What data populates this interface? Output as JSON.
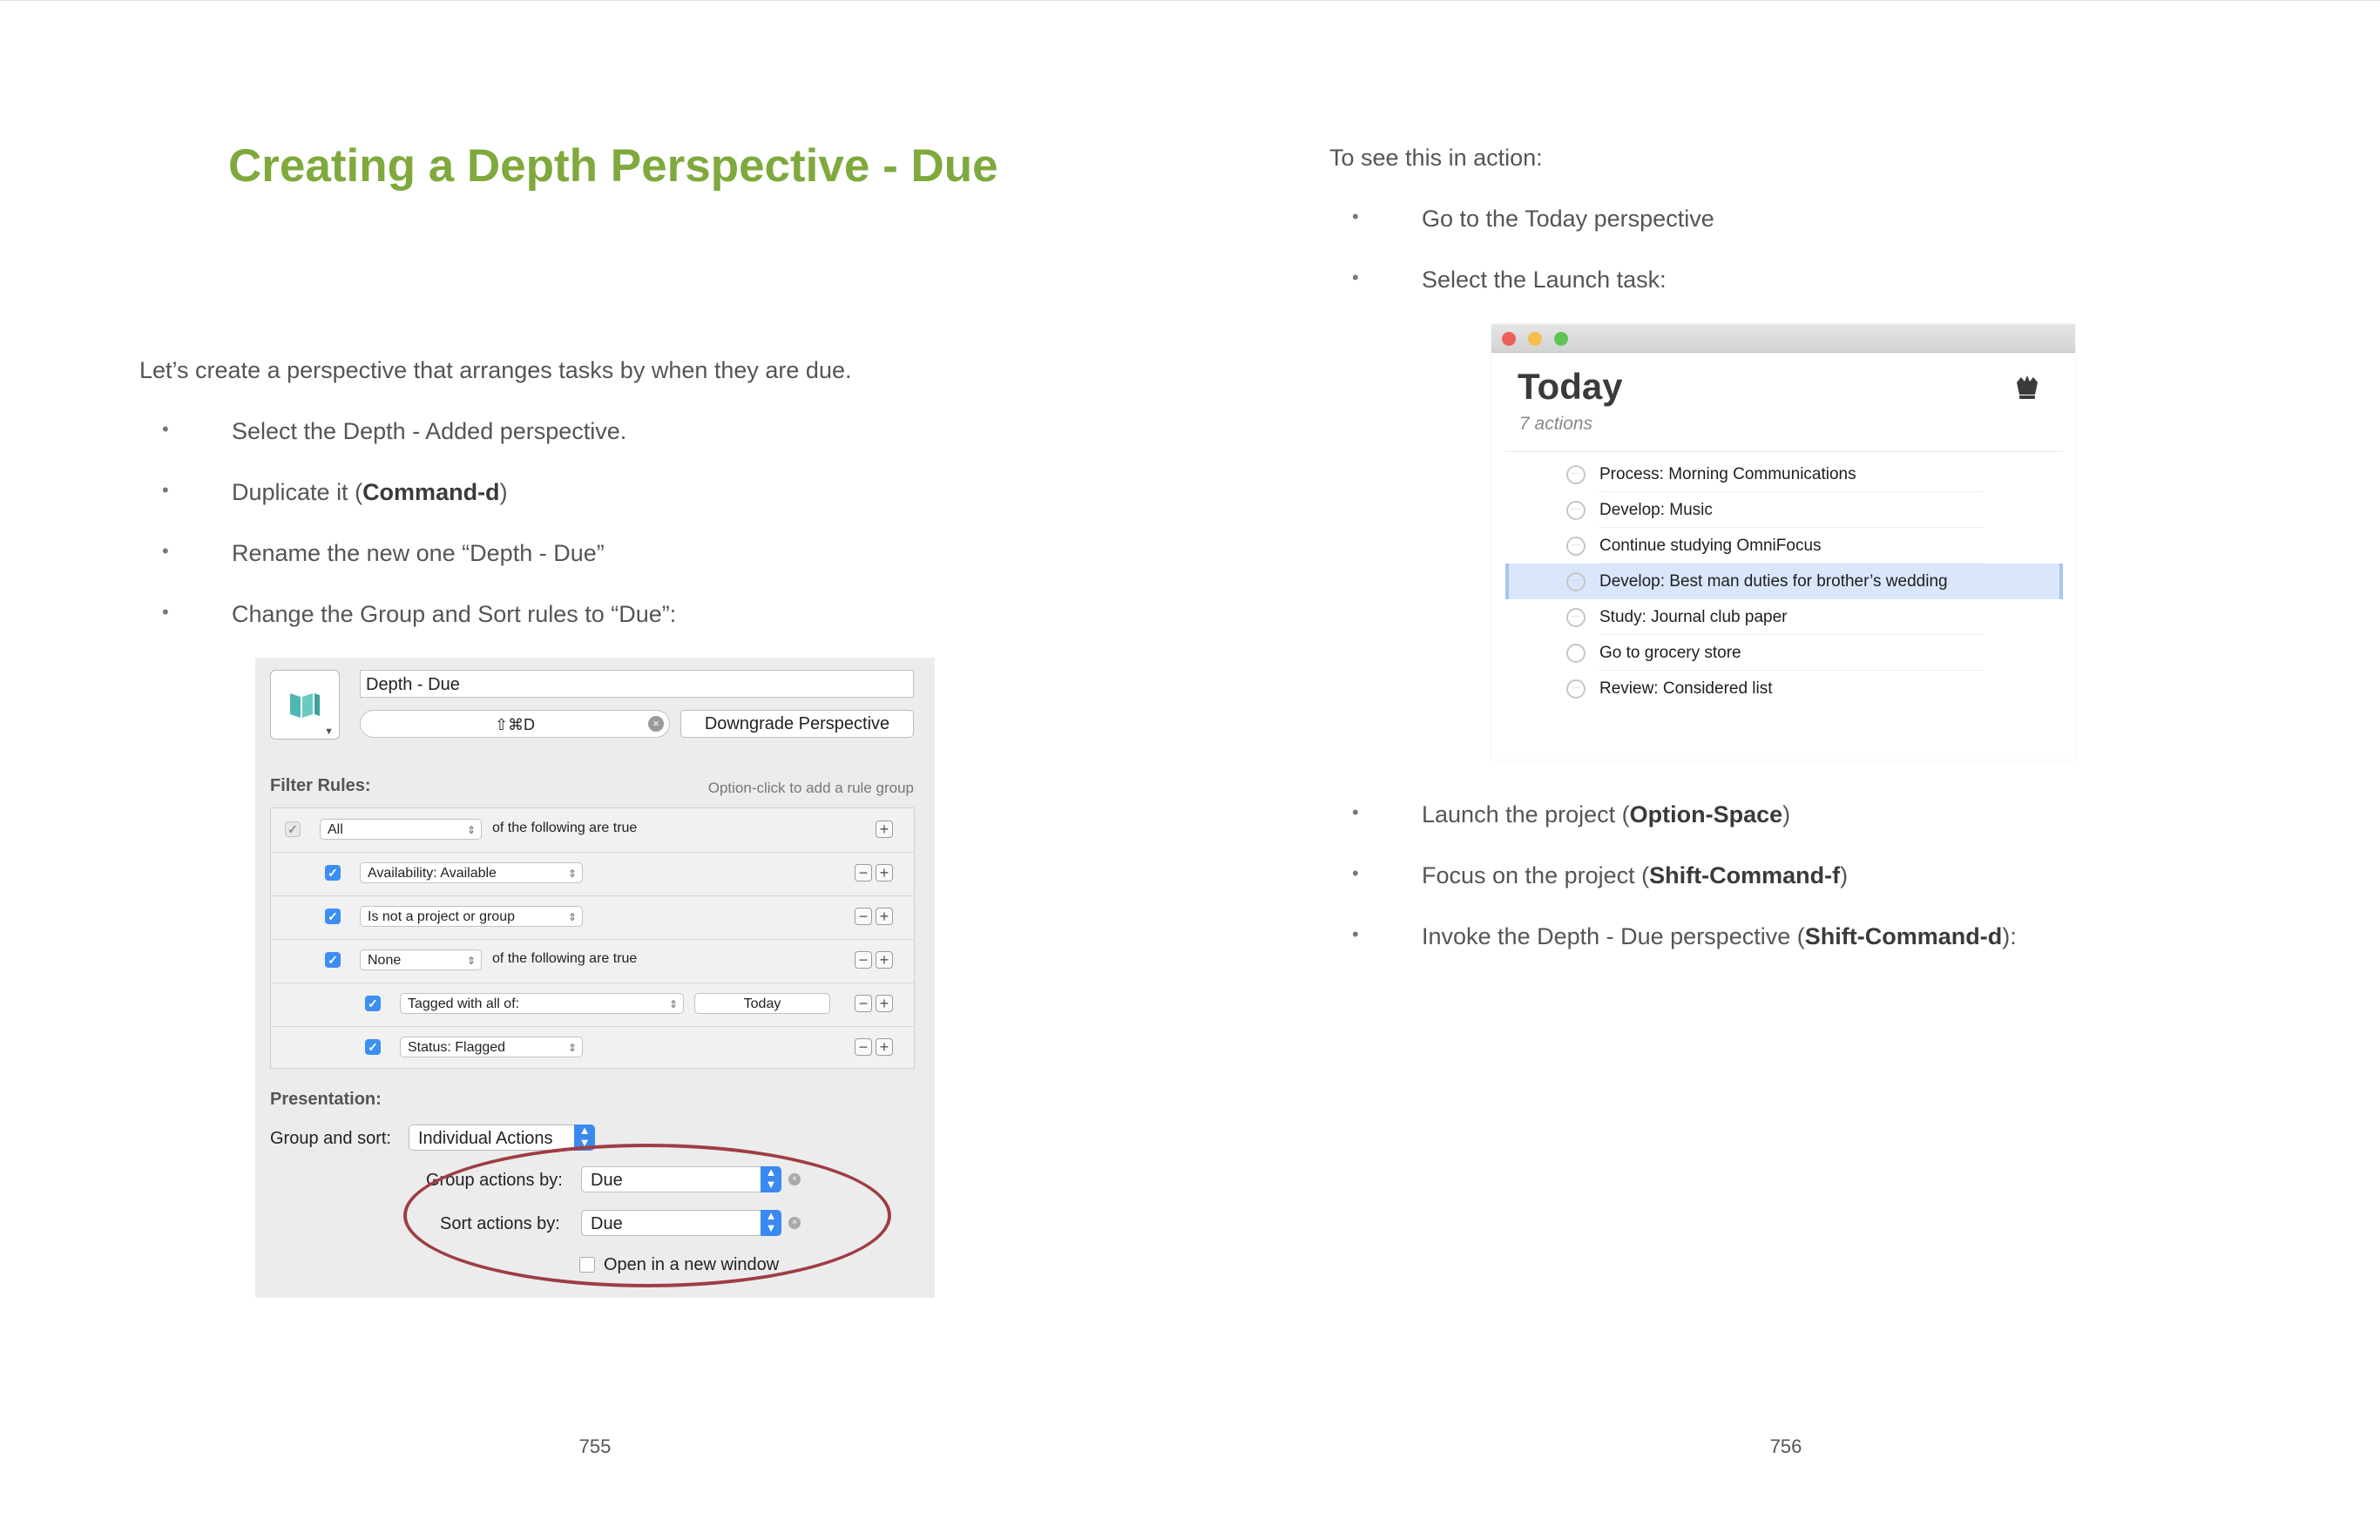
{
  "left_page": {
    "title": "Creating a Depth Perspective - Due",
    "intro": "Let’s create a perspective that arranges tasks by when they are due.",
    "bullets": [
      {
        "text": "Select the Depth - Added perspective.",
        "bold": "",
        "suffix": ""
      },
      {
        "text": "Duplicate it (",
        "bold": "Command-d",
        "suffix": ")"
      },
      {
        "text": "Rename the new one “Depth - Due”",
        "bold": "",
        "suffix": ""
      },
      {
        "text": "Change the Group and Sort rules to “Due”:",
        "bold": "",
        "suffix": ""
      }
    ],
    "page_number": "755"
  },
  "editor": {
    "perspective_name": "Depth - Due",
    "shortcut": "⇧⌘D",
    "clear_symbol": "×",
    "downgrade_button": "Downgrade Perspective",
    "filter_rules_label": "Filter Rules:",
    "option_hint": "Option-click to add a rule group",
    "rules": [
      {
        "popup": "All",
        "text": "of the following are true"
      },
      {
        "popup": "Availability: Available",
        "text": ""
      },
      {
        "popup": "Is not a project or group",
        "text": ""
      },
      {
        "popup": "None",
        "text": "of the following are true"
      },
      {
        "popup": "Tagged with all of:",
        "text": "",
        "tag": "Today"
      },
      {
        "popup": "Status: Flagged",
        "text": ""
      }
    ],
    "presentation_label": "Presentation:",
    "group_sort_label": "Group and sort:",
    "group_sort_value": "Individual Actions",
    "group_actions_label": "Group actions by:",
    "group_actions_value": "Due",
    "sort_actions_label": "Sort actions by:",
    "sort_actions_value": "Due",
    "new_window_label": "Open in a new window",
    "plus": "+",
    "minus": "−",
    "check": "✓"
  },
  "right_page": {
    "intro": "To see this in action:",
    "bullets_top": [
      {
        "text": "Go to the Today perspective",
        "bold": "",
        "suffix": ""
      },
      {
        "text": "Select the Launch task:",
        "bold": "",
        "suffix": ""
      }
    ],
    "bullets_bottom": [
      {
        "text": "Launch the project (",
        "bold": "Option-Space",
        "suffix": ")"
      },
      {
        "text": "Focus on the project (",
        "bold": "Shift-Command-f",
        "suffix": ")"
      },
      {
        "text": "Invoke the Depth - Due perspective (",
        "bold": "Shift-Command-d",
        "suffix": "):"
      }
    ],
    "page_number": "756"
  },
  "today_window": {
    "title": "Today",
    "subtitle": "7 actions",
    "tasks": [
      "Process: Morning Communications",
      "Develop: Music",
      "Continue studying OmniFocus",
      "Develop: Best man duties for brother’s wedding",
      "Study: Journal club paper",
      "Go to grocery store",
      "Review: Considered list"
    ],
    "selected_index": 3
  },
  "colors": {
    "title_green": "#7fa93d",
    "checkbox_blue": "#3d8ef3",
    "ellipse_red": "#9e3d44",
    "selection_blue": "#dae6fb",
    "traffic_red": "#ed5f57",
    "traffic_yellow": "#f5be4f",
    "traffic_green": "#5dc453"
  },
  "bullet_symbol": "•"
}
